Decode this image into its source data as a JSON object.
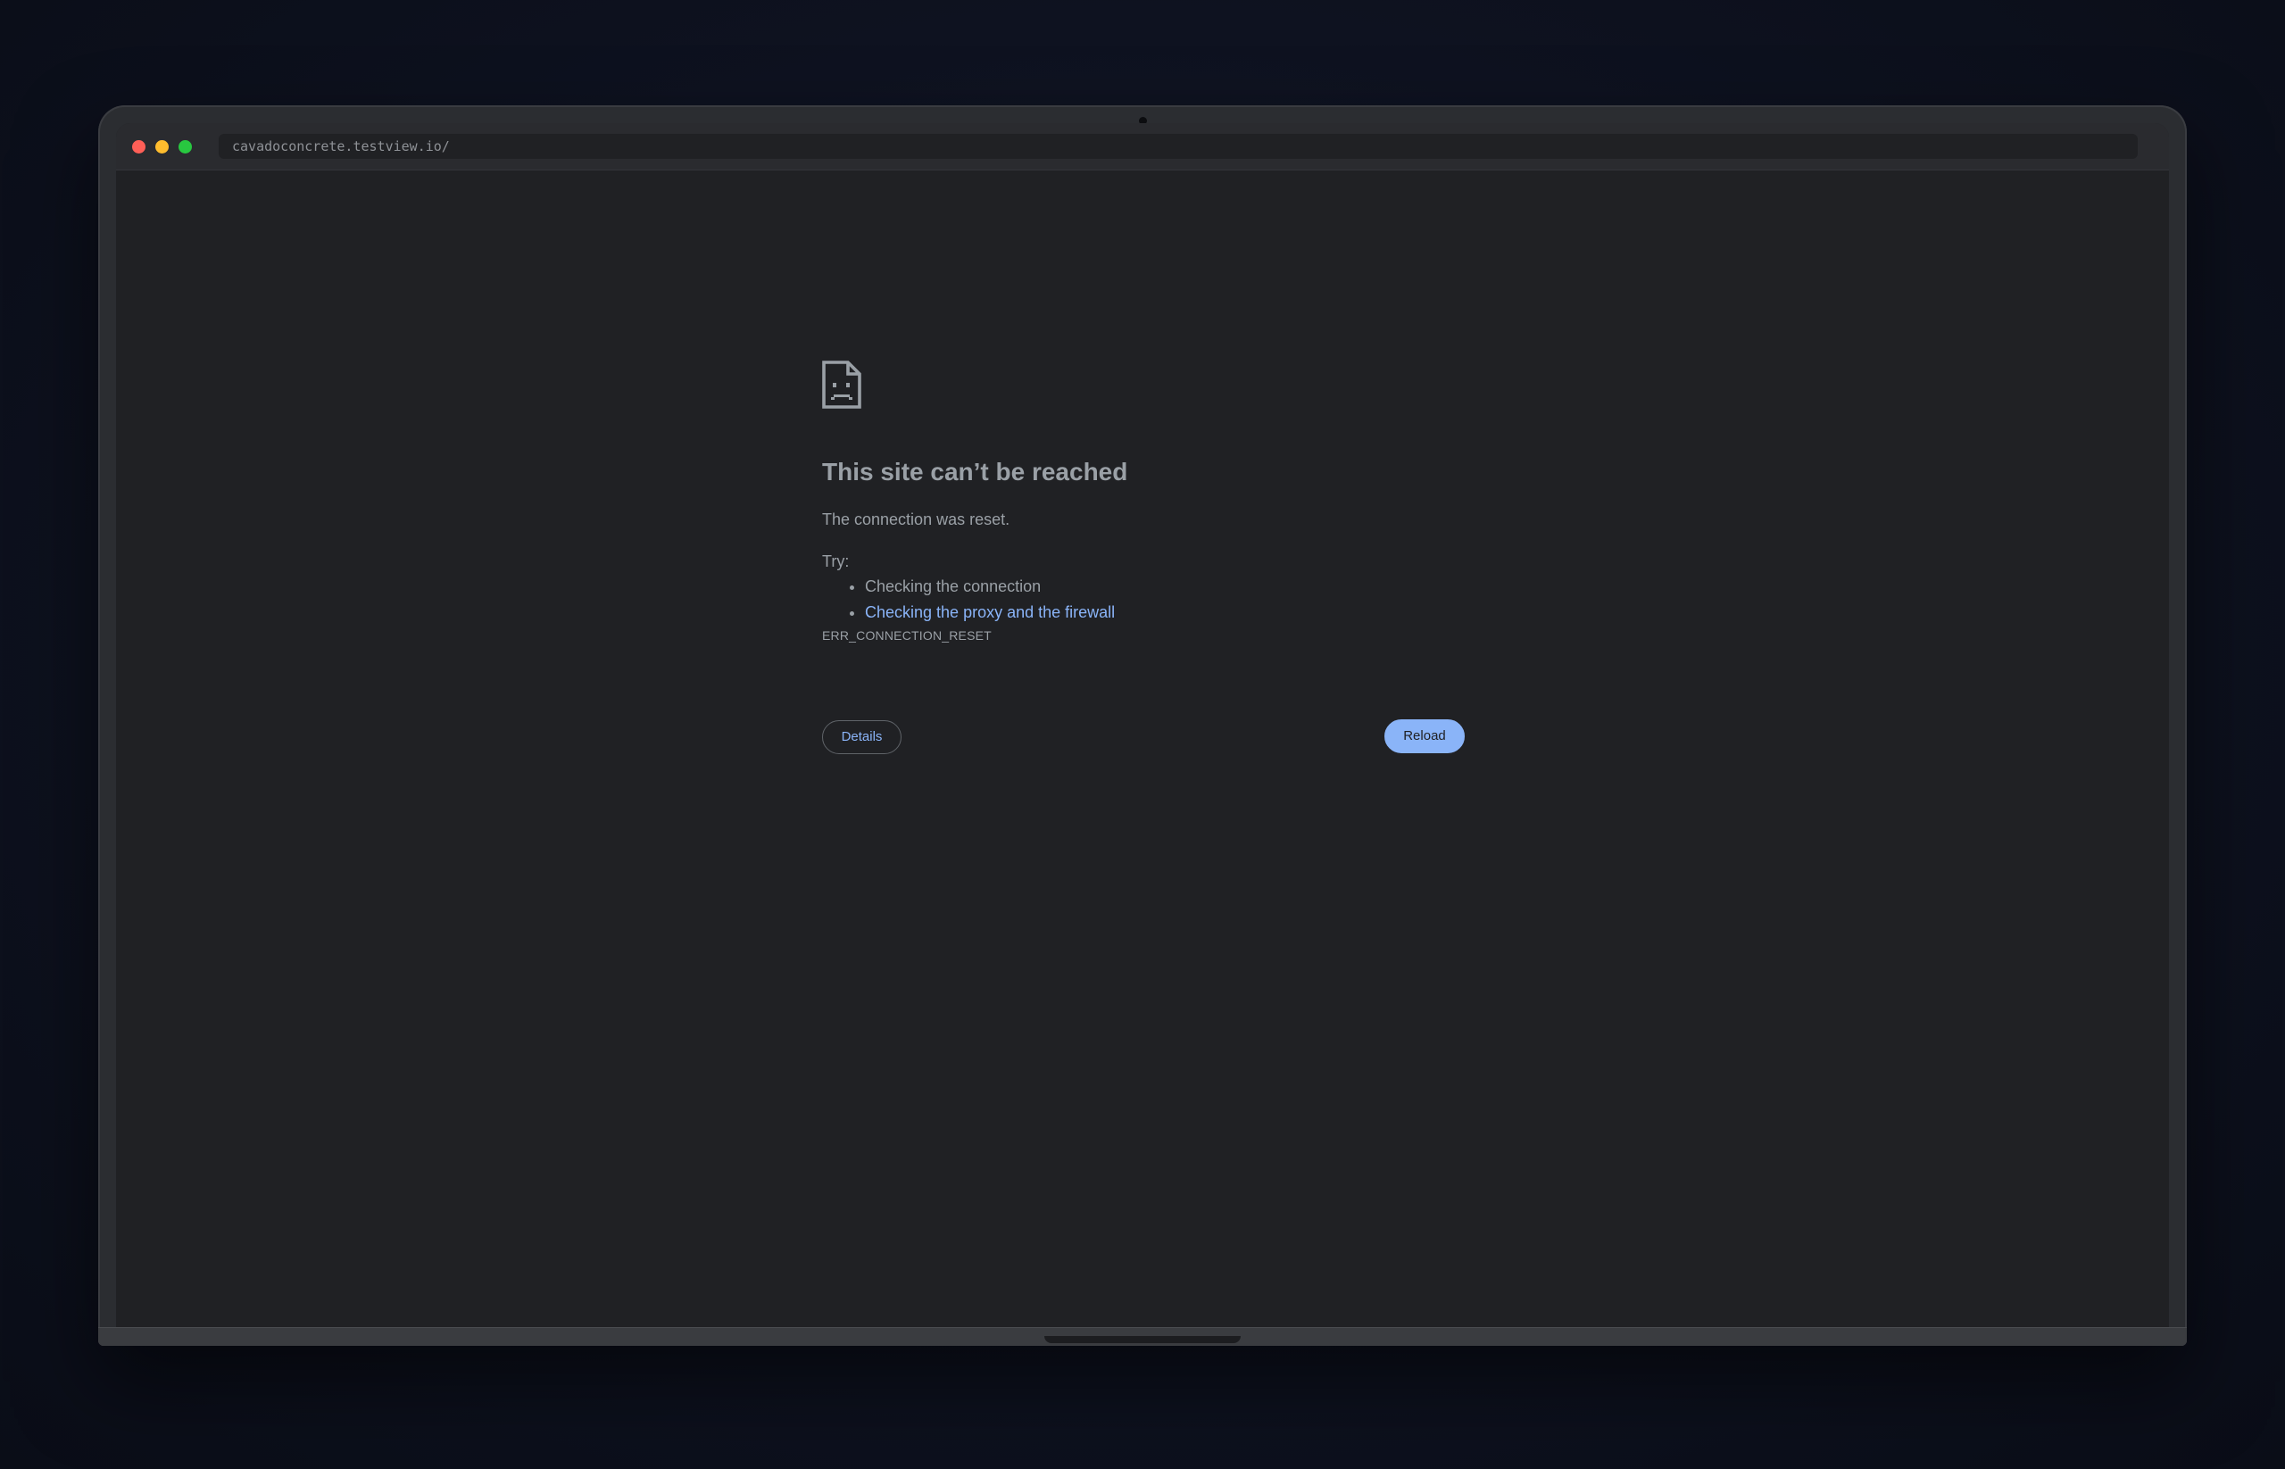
{
  "browser": {
    "url": "cavadoconcrete.testview.io/"
  },
  "error_page": {
    "icon": "sad-document-icon",
    "title": "This site can’t be reached",
    "message": "The connection was reset.",
    "try_label": "Try:",
    "suggestions": [
      {
        "label": "Checking the connection",
        "is_link": false
      },
      {
        "label": "Checking the proxy and the firewall",
        "is_link": true
      }
    ],
    "error_code": "ERR_CONNECTION_RESET",
    "details_button": "Details",
    "reload_button": "Reload"
  },
  "colors": {
    "page_background": "#202124",
    "text": "#9aa0a6",
    "link": "#8ab4f8",
    "primary_button": "#8ab4f8"
  }
}
